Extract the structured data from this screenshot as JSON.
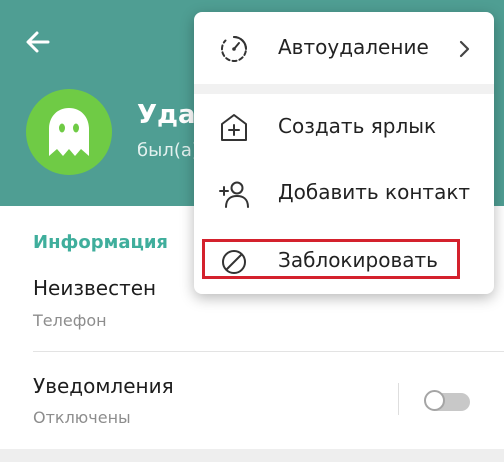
{
  "header": {
    "back_icon": "arrow-left-icon",
    "avatar_icon": "ghost-icon",
    "contact_name": "Удал",
    "contact_status": "был(а)",
    "colors": {
      "header_bg": "#4f9e93",
      "avatar_bg": "#6fcb45"
    }
  },
  "info": {
    "section_title": "Информация",
    "phone_value": "Неизвестен",
    "phone_label": "Телефон",
    "notifications_label": "Уведомления",
    "notifications_status": "Отключены",
    "notifications_enabled": false,
    "accent_color": "#3fae9c"
  },
  "menu": {
    "items": [
      {
        "label": "Автоудаление",
        "icon": "timer-icon",
        "has_submenu": true
      },
      {
        "label": "Создать ярлык",
        "icon": "add-shortcut-icon",
        "has_submenu": false
      },
      {
        "label": "Добавить контакт",
        "icon": "add-person-icon",
        "has_submenu": false
      },
      {
        "label": "Заблокировать",
        "icon": "block-icon",
        "has_submenu": false,
        "highlighted": true
      }
    ],
    "highlight_color": "#d4212d"
  }
}
